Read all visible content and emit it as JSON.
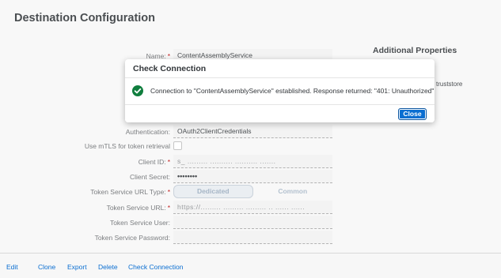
{
  "page": {
    "title": "Destination Configuration"
  },
  "side_panel": {
    "title": "Additional Properties",
    "partial_text": "truststore"
  },
  "form": {
    "name": {
      "label": "Name:",
      "value": "ContentAssemblyService",
      "required": true
    },
    "authentication": {
      "label": "Authentication:",
      "value": "OAuth2ClientCredentials"
    },
    "mtls": {
      "label": "Use mTLS for token retrieval",
      "checked": false
    },
    "client_id": {
      "label": "Client ID:",
      "value": "s_  .........   ..........  ..........  .......",
      "required": true
    },
    "client_secret": {
      "label": "Client Secret:",
      "value": "••••••••"
    },
    "token_service_url_type": {
      "label": "Token Service URL Type:",
      "required": true,
      "options": [
        "Dedicated",
        "Common"
      ],
      "selected": "Dedicated"
    },
    "token_service_url": {
      "label": "Token Service URL:",
      "value": "https://.........  .........  ......... .. ......  ......",
      "required": true
    },
    "token_service_user": {
      "label": "Token Service User:",
      "value": ""
    },
    "token_service_password": {
      "label": "Token Service Password:",
      "value": ""
    }
  },
  "required_marker": "*",
  "dialog": {
    "title": "Check Connection",
    "message": "Connection to \"ContentAssemblyService\" established. Response returned: \"401: Unauthorized\"",
    "close_label": "Close"
  },
  "footer": {
    "actions": [
      "Edit",
      "Clone",
      "Export",
      "Delete",
      "Check Connection"
    ]
  },
  "colors": {
    "accent": "#0a6ed1",
    "success": "#107e3e",
    "required": "#bb0000"
  }
}
